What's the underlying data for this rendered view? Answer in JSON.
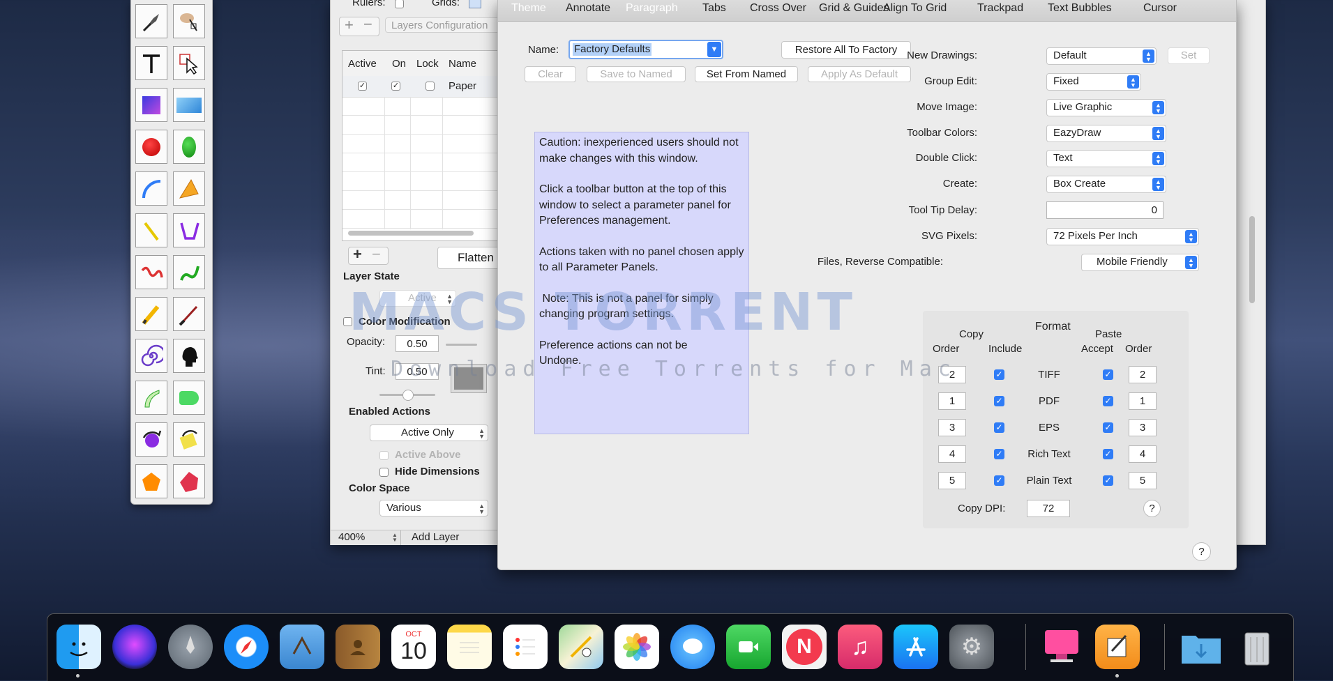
{
  "layers_window": {
    "rulers_label": "Rulers:",
    "grids_label": "Grids:",
    "layers_config_label": "Layers Configuration",
    "columns": [
      "Active",
      "On",
      "Lock",
      "Name"
    ],
    "first_row": {
      "active": true,
      "on": true,
      "lock": false,
      "name": "Paper"
    },
    "flatten_label": "Flatten",
    "layer_state_label": "Layer State",
    "layer_state_value": "Active",
    "color_modification_label": "Color Modification",
    "opacity_label": "Opacity:",
    "opacity_value": "0.50",
    "tint_label": "Tint:",
    "tint_value": "0.50",
    "enabled_actions_label": "Enabled Actions",
    "enabled_actions_value": "Active Only",
    "active_above_label": "Active Above",
    "hide_dimensions_label": "Hide Dimensions",
    "color_space_label": "Color Space",
    "color_space_value": "Various",
    "zoom_value": "400%",
    "add_layer_label": "Add Layer"
  },
  "prefs": {
    "toolbar": [
      "Theme",
      "Annotate",
      "Paragraph",
      "Tabs",
      "Cross Over",
      "Grid & Guides",
      "Align To Grid",
      "Trackpad",
      "Text Bubbles",
      "Cursor"
    ],
    "selected_toolbar": [
      "Theme",
      "Paragraph"
    ],
    "name_label": "Name:",
    "name_value": "Factory Defaults",
    "restore_all_label": "Restore All To Factory",
    "clear_label": "Clear",
    "save_to_named_label": "Save to Named",
    "set_from_named_label": "Set From Named",
    "apply_as_default_label": "Apply As Default",
    "caution_p1": "Caution: inexperienced users should not make changes with this window.",
    "caution_p2": "Click a toolbar button at the top of this window to select a parameter panel for Preferences management.",
    "caution_p3": "Actions taken with no panel chosen apply to all Parameter Panels.",
    "caution_p4": " Note: This is not a panel for simply changing program settings.",
    "caution_p5": "Preference actions can not be Undone.",
    "settings": [
      {
        "label": "New Drawings:",
        "value": "Default"
      },
      {
        "label": "Group Edit:",
        "value": "Fixed"
      },
      {
        "label": "Move Image:",
        "value": "Live Graphic"
      },
      {
        "label": "Toolbar Colors:",
        "value": "EazyDraw"
      },
      {
        "label": "Double Click:",
        "value": "Text"
      },
      {
        "label": "Create:",
        "value": "Box Create"
      },
      {
        "label": "Tool Tip Delay:",
        "value": "0"
      },
      {
        "label": "SVG Pixels:",
        "value": "72 Pixels Per Inch"
      },
      {
        "label": "Files, Reverse Compatible:",
        "value": "Mobile Friendly"
      }
    ],
    "set_label": "Set",
    "format": {
      "copy_label": "Copy",
      "format_label": "Format",
      "paste_label": "Paste",
      "order_label": "Order",
      "include_label": "Include",
      "accept_label": "Accept",
      "rows": [
        {
          "copy_order": "2",
          "name": "TIFF",
          "paste_order": "2"
        },
        {
          "copy_order": "1",
          "name": "PDF",
          "paste_order": "1"
        },
        {
          "copy_order": "3",
          "name": "EPS",
          "paste_order": "3"
        },
        {
          "copy_order": "4",
          "name": "Rich Text",
          "paste_order": "4"
        },
        {
          "copy_order": "5",
          "name": "Plain Text",
          "paste_order": "5"
        }
      ],
      "copy_dpi_label": "Copy DPI:",
      "copy_dpi_value": "72"
    },
    "help_glyph": "?"
  },
  "watermark": {
    "title": "MACS TORRENT",
    "subtitle": "Download Free Torrents for Mac"
  },
  "dock": {
    "calendar_month": "OCT",
    "calendar_day": "10"
  },
  "colors": {
    "accent": "#2f7cf6",
    "caution_bg": "#d7d8fb"
  }
}
